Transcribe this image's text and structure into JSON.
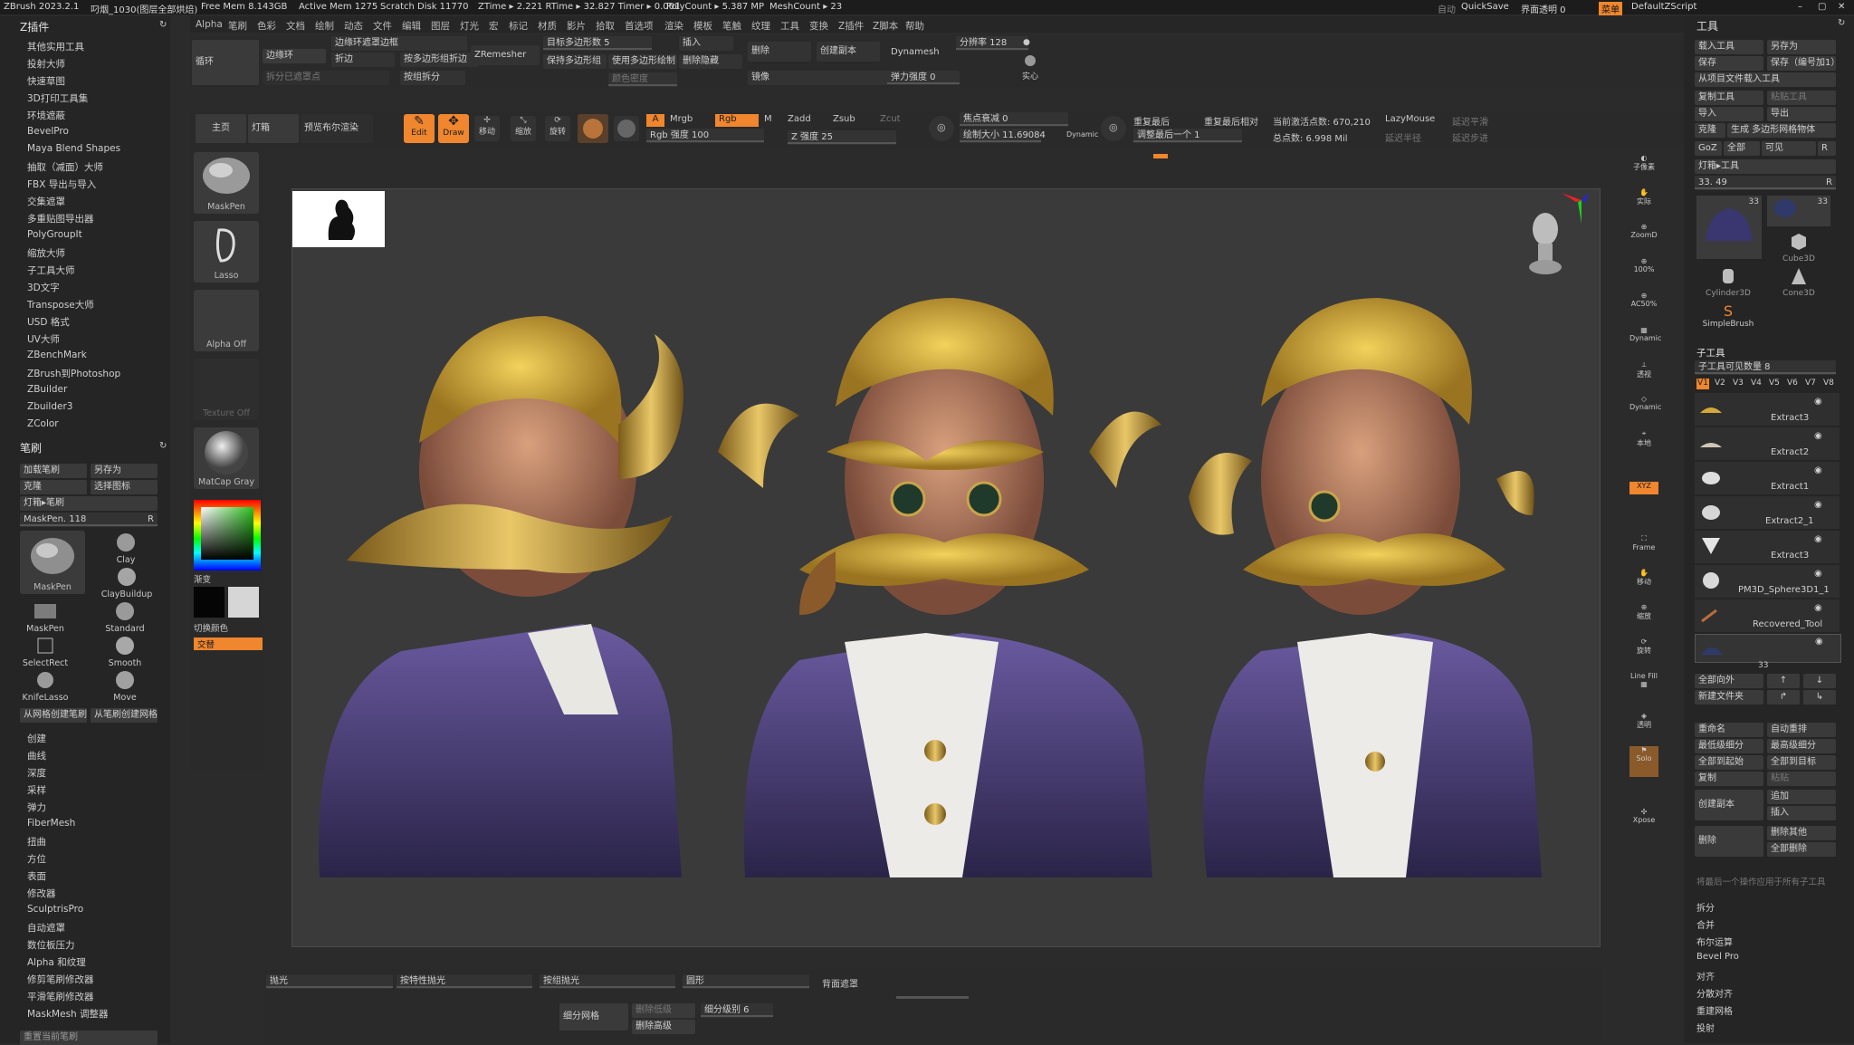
{
  "titlebar": {
    "app": "ZBrush 2023.2.1",
    "doc": "叼烟_1030(图层全部烘焙)",
    "free_mem": "Free Mem 8.143GB",
    "active_mem": "Active Mem 1275",
    "scratch": "Scratch Disk 11770",
    "ztime": "ZTime ▸ 2.221 RTime ▸ 32.827 Timer ▸ 0.001",
    "polycount": "PolyCount ▸ 5.387 MP",
    "meshcount": "MeshCount ▸ 23",
    "auto": "自动",
    "quicksave": "QuickSave",
    "transparency": "界面透明 0",
    "menu": "菜单",
    "script": "DefaultZScript"
  },
  "menubar": [
    "Alpha",
    "笔刷",
    "色彩",
    "文档",
    "绘制",
    "动态",
    "文件",
    "编辑",
    "图层",
    "灯光",
    "宏",
    "标记",
    "材质",
    "影片",
    "拾取",
    "首选项",
    "渲染",
    "模板",
    "笔触",
    "纹理",
    "工具",
    "变换",
    "Z插件",
    "Z脚本",
    "帮助"
  ],
  "left_panel": {
    "plugin_title": "Z插件",
    "plugins": [
      "其他实用工具",
      "投射大师",
      "快速草图",
      "3D打印工具集",
      "环境遮蔽",
      "BevelPro",
      "Maya Blend Shapes",
      "抽取（减面）大师",
      "FBX 导出与导入",
      "交集遮罩",
      "多重贴图导出器",
      "PolyGroupIt",
      "缩放大师",
      "子工具大师",
      "3D文字",
      "Transpose大师",
      "USD 格式",
      "UV大师",
      "ZBenchMark",
      "ZBrush到Photoshop",
      "ZBuilder",
      "Zbuilder3",
      "ZColor"
    ],
    "brush_title": "笔刷",
    "brush_btns": {
      "load": "加载笔刷",
      "save_as": "另存为",
      "clone": "克隆",
      "select_icon": "选择图标",
      "lightbox": "灯箱▸笔刷"
    },
    "brush_slider": "MaskPen. 118",
    "brush_slider_key": "R",
    "brushes": [
      "MaskPen",
      "Clay",
      "ClayBuildup",
      "MaskPen",
      "Standard",
      "SelectRect",
      "Smooth",
      "KnifeLasso",
      "Move"
    ],
    "brush_ops": {
      "from_mesh": "从网格创建笔刷",
      "from_brush": "从笔刷创建网格"
    },
    "brush_sections": [
      "创建",
      "曲线",
      "深度",
      "采样",
      "弹力",
      "FiberMesh",
      "扭曲",
      "方位",
      "表面",
      "修改器",
      "SculptrisPro",
      "自动遮罩",
      "数位板压力",
      "Alpha 和纹理",
      "修剪笔刷修改器",
      "平滑笔刷修改器",
      "MaskMesh 调整器"
    ],
    "reset": "重置当前笔刷"
  },
  "toolbar_top": {
    "loop": "循环",
    "edge_loop": "边缘环",
    "edge_loop_mask": "边缘环遮罩边框",
    "fold": "折边",
    "group_fold": "按多边形组折边",
    "split_hidden": "拆分已遮罩点",
    "split_groups": "按组拆分",
    "zremesher": "ZRemesher",
    "target_poly": "目标多边形数 5",
    "keep_groups": "保持多边形组",
    "use_paint": "使用多边形绘制",
    "color_density": "颜色密度",
    "insert": "插入",
    "delete_hidden": "删除隐藏",
    "delete": "删除",
    "create_copy": "创建副本",
    "dynamesh": "Dynamesh",
    "resolution": "分辨率 128",
    "mirror": "镜像",
    "elastic": "弹力强度 0",
    "solid": "实心"
  },
  "toolbar_row2": {
    "home": "主页",
    "lightbox": "灯箱",
    "preview": "预览布尔渲染",
    "edit": "Edit",
    "draw": "Draw",
    "move": "移动",
    "scale": "缩放",
    "rotate": "旋转",
    "a": "A",
    "mrgb": "Mrgb",
    "rgb": "Rgb",
    "m": "M",
    "zadd": "Zadd",
    "zsub": "Zsub",
    "zcut": "Zcut",
    "rgb_intensity": "Rgb 强度 100",
    "z_intensity": "Z 强度 25",
    "focal": "焦点衰减 0",
    "draw_size": "绘制大小 11.69084",
    "dynamic": "Dynamic",
    "repeat_last": "重复最后",
    "repeat_rel": "重复最后相对",
    "adjust_last": "调整最后一个 1",
    "active_points": "当前激活点数: 670,210",
    "total_points": "总点数: 6.998 Mil",
    "lazymouse": "LazyMouse",
    "lazy_smooth": "延迟平滑",
    "lazy_radius": "延迟半径",
    "lazy_step": "延迟步进"
  },
  "left_tools": {
    "maskpen": "MaskPen",
    "lasso": "Lasso",
    "alpha_off": "Alpha Off",
    "texture_off": "Texture Off",
    "matcap": "MatCap Gray",
    "gradient": "渐变",
    "switch_color": "切换颜色",
    "alternate": "交替"
  },
  "right_icons": [
    "子像素",
    "实际",
    "ZoomD",
    "100%",
    "AC50%",
    "Dynamic",
    "透视",
    "Dynamic",
    "本地",
    "XYZ",
    "Frame",
    "移动",
    "缩放",
    "旋转",
    "Line Fill",
    "PolyF",
    "透明",
    "Solo",
    "Xpose"
  ],
  "tool_panel": {
    "title": "工具",
    "load": "载入工具",
    "save_as": "另存为",
    "save": "保存",
    "save_inc": "保存（编号加1）",
    "load_project": "从项目文件载入工具",
    "copy": "复制工具",
    "paste": "粘贴工具",
    "import": "导入",
    "export": "导出",
    "clone": "克隆",
    "make_polymesh": "生成 多边形网格物体",
    "goz": "GoZ",
    "all": "全部",
    "visible": "可见",
    "r": "R",
    "lightbox_tools": "灯箱▸工具",
    "slider_val": "33. 49",
    "slider_r": "R",
    "tool_thumbs": [
      "33",
      "33",
      "Cube3D",
      "Cylinder3D",
      "Cone3D",
      "SimpleBrush"
    ],
    "subtool_title": "子工具",
    "subtool_count": "子工具可见数量 8",
    "versions": [
      "V1",
      "V2",
      "V3",
      "V4",
      "V5",
      "V6",
      "V7",
      "V8"
    ],
    "subtools": [
      "Extract3",
      "Extract2",
      "Extract1",
      "Extract2_1",
      "Extract3",
      "PM3D_Sphere3D1_1",
      "Recovered_Tool"
    ],
    "bottom_num": "33",
    "all_out": "全部向外",
    "new_folder": "新建文件夹",
    "rename": "重命名",
    "auto_reorder": "自动重排",
    "lowest": "最低级细分",
    "highest": "最高级细分",
    "all_to_start": "全部到起始",
    "all_to_target": "全部到目标",
    "duplicate": "复制",
    "paste2": "粘贴",
    "create_copy": "创建副本",
    "append": "追加",
    "insert": "插入",
    "delete": "删除",
    "delete_others": "删除其他",
    "delete_all": "全部删除",
    "note": "将最后一个操作应用于所有子工具",
    "sections": [
      "拆分",
      "合并",
      "布尔运算",
      "Bevel Pro",
      "对齐",
      "分散对齐",
      "重建网格",
      "投射"
    ]
  },
  "bottom_bar": {
    "polish": "抛光",
    "feature_polish": "按特性抛光",
    "group_polish": "按组抛光",
    "round": "圆形",
    "backface": "背面遮罩",
    "subdiv": "细分网格",
    "del_lower": "删除低级",
    "del_higher": "删除高级",
    "subdiv_level": "细分级别 6"
  },
  "colors": {
    "accent": "#f0862e",
    "bg": "#2b2b2b",
    "panel": "#252525",
    "viewport": "#3a3a3a"
  }
}
